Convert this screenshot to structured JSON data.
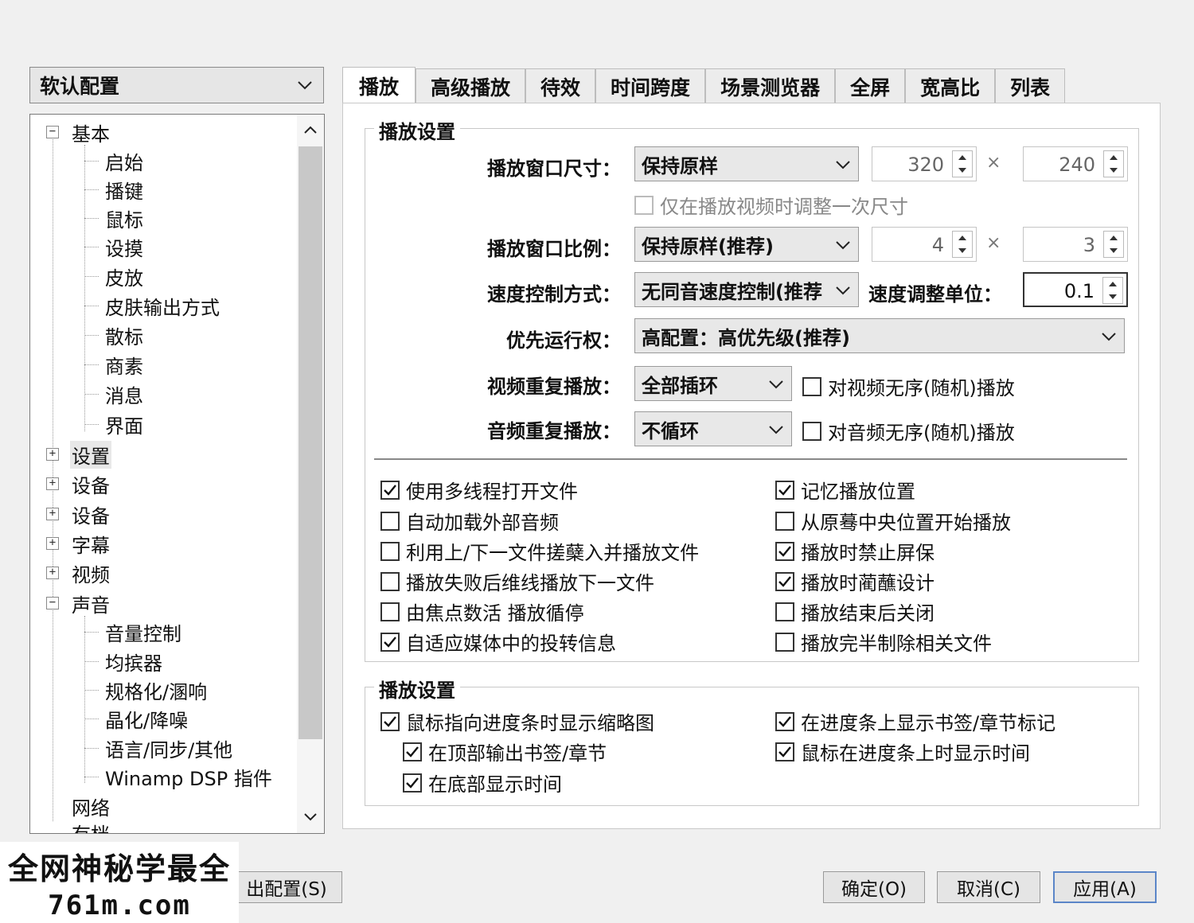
{
  "profile": {
    "selected": "软认配置"
  },
  "tree": {
    "basic": {
      "label": "基本",
      "expander": "−",
      "children": [
        "启始",
        "播键",
        "鼠标",
        "设摸",
        "皮放",
        "皮肤输出方式",
        "散标",
        "商素",
        "消息",
        "界面"
      ]
    },
    "collapsed1": [
      {
        "label": "设置",
        "expander": "+"
      },
      {
        "label": "设备",
        "expander": "+"
      },
      {
        "label": "设备",
        "expander": "+"
      },
      {
        "label": "字幕",
        "expander": "+"
      },
      {
        "label": "视频",
        "expander": "+"
      }
    ],
    "sound": {
      "label": "声音",
      "expander": "−",
      "children": [
        "音量控制",
        "均摈器",
        "规格化/溷响",
        "晶化/降噪",
        "语言/同步/其他",
        "Winamp DSP 指件"
      ]
    },
    "network": {
      "label": "网络"
    },
    "cutoff": {
      "label": "有档"
    }
  },
  "watermark": {
    "line1": "全网神秘学最全",
    "line2": "761m.com"
  },
  "buttons": {
    "save": "出配置(S)",
    "ok": "确定(O)",
    "cancel": "取消(C)",
    "apply": "应用(A)"
  },
  "tabs": [
    "播放",
    "高级播放",
    "待效",
    "时间跨度",
    "场景测览器",
    "全屏",
    "宽高比",
    "列表"
  ],
  "group1": {
    "title": "播放设置",
    "window_size": {
      "label": "播放窗口尺寸：",
      "value": "保持原样",
      "w": "320",
      "h": "240"
    },
    "resize_once": "仅在播放视频时调整一次尺寸",
    "window_ratio": {
      "label": "播放窗口比例：",
      "value": "保持原样(推荐)",
      "w": "4",
      "h": "3"
    },
    "speed_mode": {
      "label": "速度控制方式：",
      "value": "无同音速度控制(推荐",
      "unit_label": "速度调整单位：",
      "unit_value": "0.1"
    },
    "priority": {
      "label": "优先运行权：",
      "value": "高配置：高优先级(推荐)"
    },
    "video_repeat": {
      "label": "视频重复播放：",
      "value": "全部插环",
      "random": "对视频无序(随机)播放"
    },
    "audio_repeat": {
      "label": "音频重复播放：",
      "value": "不循环",
      "random": "对音频无序(随机)播放"
    },
    "times_sign": "×",
    "left_checks": [
      {
        "label": "使用多线程打开文件",
        "checked": true
      },
      {
        "label": "自动加载外部音频",
        "checked": false
      },
      {
        "label": "利用上/下一文件搓蘖入并播放文件",
        "checked": false
      },
      {
        "label": "播放失败后维线播放下一文件",
        "checked": false
      },
      {
        "label": "由焦点数活 播放循停",
        "checked": false
      },
      {
        "label": "自适应媒体中的投转信息",
        "checked": true
      }
    ],
    "right_checks": [
      {
        "label": "记忆播放位置",
        "checked": true
      },
      {
        "label": "从原蓦中央位置开始播放",
        "checked": false
      },
      {
        "label": "播放时禁止屏保",
        "checked": true
      },
      {
        "label": "播放时蔺蘸设计",
        "checked": true
      },
      {
        "label": "播放结束后关闭",
        "checked": false
      },
      {
        "label": "播放完半制除相关文件",
        "checked": false
      }
    ]
  },
  "group2": {
    "title": "播放设置",
    "checks": [
      {
        "label": "鼠标指向进度条时显示缩略图",
        "checked": true
      },
      {
        "label": "在顶部输出书签/章节",
        "checked": true
      },
      {
        "label": "在底部显示时间",
        "checked": true
      },
      {
        "label": "在进度条上显示书签/章节标记",
        "checked": true
      },
      {
        "label": "鼠标在进度条上时显示时间",
        "checked": true
      }
    ]
  },
  "check_mark": "✓"
}
